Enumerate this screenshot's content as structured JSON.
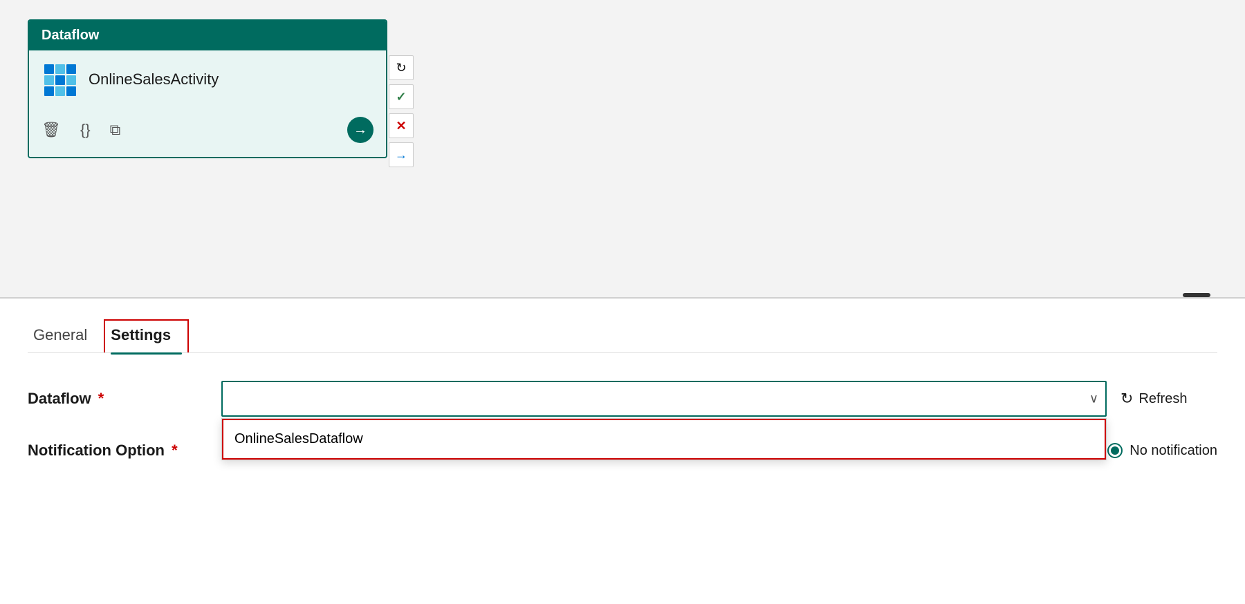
{
  "canvas": {
    "background_color": "#f3f3f3"
  },
  "dataflow_node": {
    "header_label": "Dataflow",
    "header_bg": "#006b5f",
    "body_bg": "#e8f5f3",
    "activity_name": "OnlineSalesActivity",
    "actions": {
      "delete_label": "🗑",
      "braces_label": "{}",
      "copy_label": "⧉",
      "arrow_label": "→"
    }
  },
  "side_connectors": {
    "redo_label": "↻",
    "check_label": "✓",
    "cross_label": "✕",
    "arrow_label": "→"
  },
  "tabs": [
    {
      "id": "general",
      "label": "General",
      "active": false
    },
    {
      "id": "settings",
      "label": "Settings",
      "active": true
    }
  ],
  "settings": {
    "dataflow_field": {
      "label": "Dataflow",
      "required": true,
      "placeholder": "",
      "dropdown_options": [
        {
          "value": "OnlineSalesDataflow",
          "label": "OnlineSalesDataflow"
        }
      ],
      "selected": ""
    },
    "notification_field": {
      "label": "Notification Option",
      "required": true
    },
    "refresh_button": {
      "label": "Refresh"
    },
    "no_notification": {
      "label": "No notification"
    }
  }
}
